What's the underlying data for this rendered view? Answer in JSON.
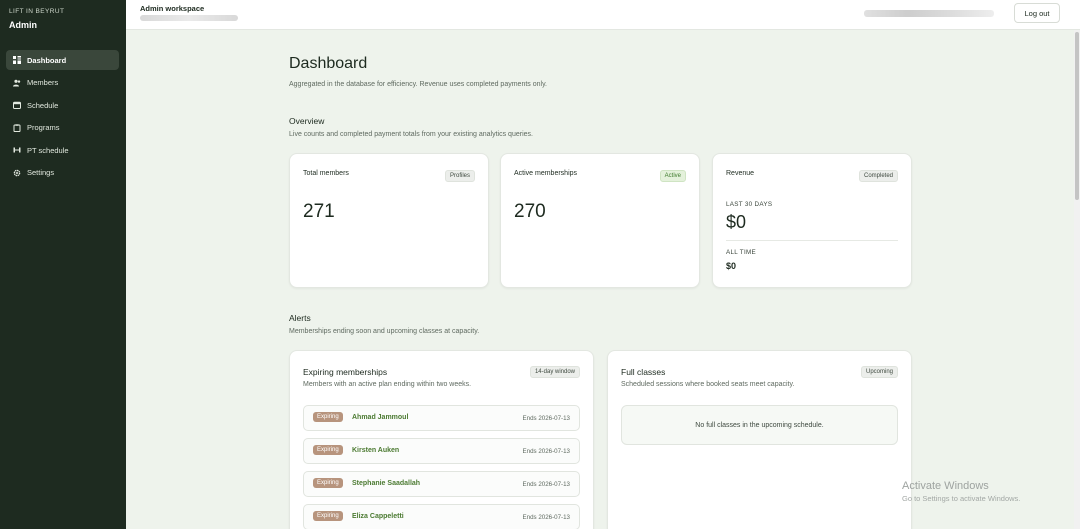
{
  "sidebar": {
    "brand_small": "LIFT IN BEYRUT",
    "brand_title": "Admin",
    "items": [
      {
        "label": "Dashboard",
        "icon": "grid-icon",
        "active": true
      },
      {
        "label": "Members",
        "icon": "users-icon"
      },
      {
        "label": "Schedule",
        "icon": "calendar-icon"
      },
      {
        "label": "Programs",
        "icon": "clipboard-icon"
      },
      {
        "label": "PT schedule",
        "icon": "dumbbell-icon"
      },
      {
        "label": "Settings",
        "icon": "gear-icon"
      }
    ]
  },
  "topbar": {
    "workspace_title": "Admin workspace",
    "logout_label": "Log out"
  },
  "page": {
    "title": "Dashboard",
    "description": "Aggregated in the database for efficiency. Revenue uses completed payments only."
  },
  "overview": {
    "title": "Overview",
    "description": "Live counts and completed payment totals from your existing analytics queries.",
    "total_members": {
      "label": "Total members",
      "badge": "Profiles",
      "value": "271"
    },
    "active_memberships": {
      "label": "Active memberships",
      "badge": "Active",
      "value": "270"
    },
    "revenue": {
      "label": "Revenue",
      "badge": "Completed",
      "last30_label": "LAST 30 DAYS",
      "last30_value": "$0",
      "alltime_label": "ALL TIME",
      "alltime_value": "$0"
    }
  },
  "alerts": {
    "title": "Alerts",
    "description": "Memberships ending soon and upcoming classes at capacity.",
    "expiring": {
      "title": "Expiring memberships",
      "badge": "14-day window",
      "description": "Members with an active plan ending within two weeks.",
      "rows": [
        {
          "status": "Expiring",
          "name": "Ahmad Jammoul",
          "ends": "Ends 2026-07-13"
        },
        {
          "status": "Expiring",
          "name": "Kirsten Auken",
          "ends": "Ends 2026-07-13"
        },
        {
          "status": "Expiring",
          "name": "Stephanie Saadallah",
          "ends": "Ends 2026-07-13"
        },
        {
          "status": "Expiring",
          "name": "Eliza Cappeletti",
          "ends": "Ends 2026-07-13"
        }
      ]
    },
    "full_classes": {
      "title": "Full classes",
      "badge": "Upcoming",
      "description": "Scheduled sessions where booked seats meet capacity.",
      "empty_text": "No full classes in the upcoming schedule."
    }
  },
  "watermark": {
    "line1": "Activate Windows",
    "line2": "Go to Settings to activate Windows."
  },
  "colors": {
    "sidebar_bg": "#1e2b20",
    "page_bg": "#eef3ec",
    "accent_green": "#4b7a31",
    "expiring_badge": "#b7947d"
  }
}
